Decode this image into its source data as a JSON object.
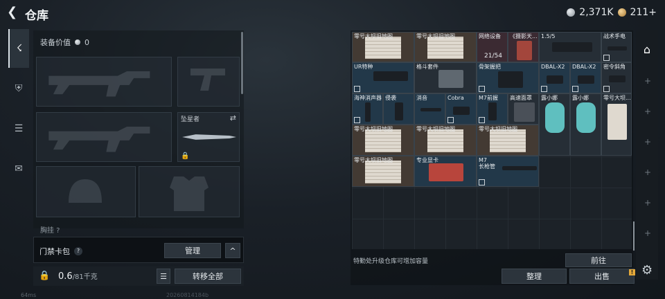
{
  "header": {
    "title": "仓库",
    "back_icon": "back-arrow-icon",
    "currency": [
      {
        "icon": "silver-coin-icon",
        "value": "2,371K"
      },
      {
        "icon": "gold-coin-icon",
        "value": "211+"
      }
    ]
  },
  "rail": {
    "items": [
      {
        "icon": "pistol-icon",
        "active": true
      },
      {
        "icon": "armor-icon"
      },
      {
        "icon": "clipboard-icon"
      },
      {
        "icon": "briefcase-icon"
      }
    ]
  },
  "equipment": {
    "value_label": "装备价值",
    "value": "0",
    "knife_label": "坠星者",
    "partial_label": "胸挂 ?"
  },
  "keycard": {
    "label": "门禁卡包",
    "help": "?",
    "manage": "管理",
    "collapse": "^"
  },
  "weight": {
    "current": "0.6",
    "max": "/81千克",
    "transfer_all": "转移全部"
  },
  "status": {
    "ping": "64ms",
    "build": "20260814184b"
  },
  "storage": {
    "items": [
      {
        "name": "零号大坝旧地图",
        "style": "paper"
      },
      {
        "name": "零号大坝旧地图",
        "style": "paper"
      },
      {
        "name": "网络设备",
        "style": "red",
        "count": "21/54"
      },
      {
        "name": "《摄影天...",
        "style": "red"
      },
      {
        "name": "1.5/5",
        "style": "dark"
      },
      {
        "name": "战术手电",
        "style": "dark"
      },
      {
        "name": "UR特种",
        "style": "blue"
      },
      {
        "name": "格斗套件",
        "style": "dark"
      },
      {
        "name": "骨架握把",
        "style": "blue"
      },
      {
        "name": "DBAL-X2",
        "style": "blue"
      },
      {
        "name": "DBAL-X2",
        "style": "blue"
      },
      {
        "name": "密令斜角",
        "style": "dark"
      },
      {
        "name": "海神消声器",
        "style": "blue"
      },
      {
        "name": "侵袭",
        "style": "blue"
      },
      {
        "name": "消音",
        "style": "blue"
      },
      {
        "name": "Cobra",
        "style": "blue"
      },
      {
        "name": "M7前握",
        "style": "blue"
      },
      {
        "name": "高速面罩",
        "style": "dark"
      },
      {
        "name": "露小娜",
        "style": "dark"
      },
      {
        "name": "露小娜",
        "style": "dark"
      },
      {
        "name": "零号大坝...",
        "style": "dark"
      },
      {
        "name": "零号大坝旧地图",
        "style": "paper"
      },
      {
        "name": "零号大坝旧地图",
        "style": "paper"
      },
      {
        "name": "零号大坝旧地图",
        "style": "paper"
      },
      {
        "name": "零号大坝旧地图",
        "style": "paper"
      },
      {
        "name": "专业显卡",
        "style": "blue"
      },
      {
        "name": "M7\n长枪管",
        "style": "blue"
      }
    ],
    "upgrade_hint": "特勤处升级仓库可增加容量",
    "goto": "前往",
    "sort": "整理",
    "sell": "出售",
    "warn": "!"
  }
}
